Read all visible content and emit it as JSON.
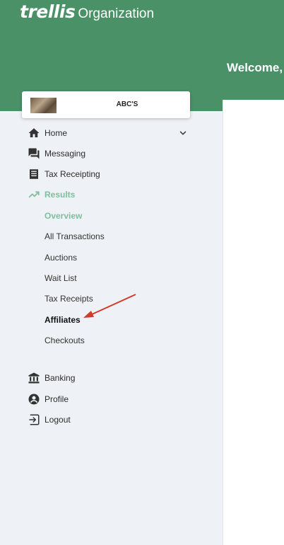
{
  "header": {
    "brand_logo": "trellis",
    "brand_subtitle": "Organization",
    "welcome": "Welcome,"
  },
  "org": {
    "name": "ABC'S"
  },
  "nav": {
    "home": "Home",
    "messaging": "Messaging",
    "tax_receipting": "Tax Receipting",
    "results": "Results",
    "banking": "Banking",
    "profile": "Profile",
    "logout": "Logout"
  },
  "results_submenu": {
    "overview": "Overview",
    "all_transactions": "All Transactions",
    "auctions": "Auctions",
    "wait_list": "Wait List",
    "tax_receipts": "Tax Receipts",
    "affiliates": "Affiliates",
    "checkouts": "Checkouts"
  },
  "colors": {
    "header_green": "#4a9168",
    "active_green": "#7fbf9d",
    "annotation_arrow": "#d23a2a"
  },
  "icons": [
    "home-icon",
    "chevron-down-icon",
    "chat-icon",
    "receipt-icon",
    "trending-up-icon",
    "bank-icon",
    "account-circle-icon",
    "logout-icon"
  ]
}
